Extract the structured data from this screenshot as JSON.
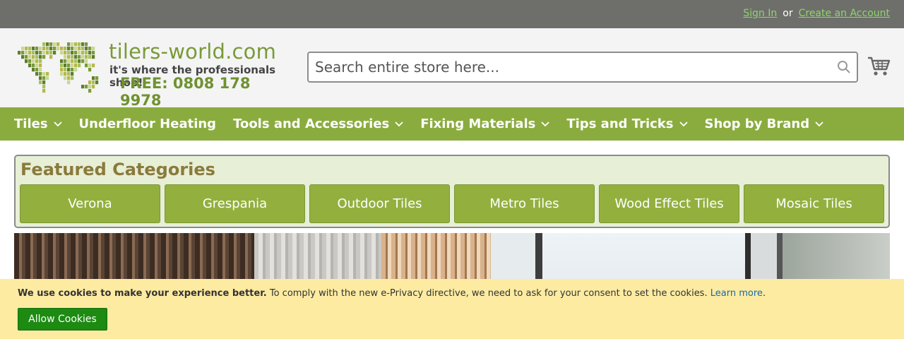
{
  "topbar": {
    "sign_in": "Sign In",
    "or": "or",
    "create_account": "Create an Account"
  },
  "logo": {
    "site": "tilers-world.com",
    "tagline": "it's where the professionals shop!",
    "phone": "FREE: 0808 178 9978"
  },
  "search": {
    "placeholder": "Search entire store here..."
  },
  "nav": {
    "items": [
      {
        "label": "Tiles",
        "has_dropdown": true
      },
      {
        "label": "Underfloor Heating",
        "has_dropdown": false
      },
      {
        "label": "Tools and Accessories",
        "has_dropdown": true
      },
      {
        "label": "Fixing Materials",
        "has_dropdown": true
      },
      {
        "label": "Tips and Tricks",
        "has_dropdown": true
      },
      {
        "label": "Shop by Brand",
        "has_dropdown": true
      }
    ]
  },
  "featured": {
    "title": "Featured Categories",
    "categories": [
      "Verona",
      "Grespania",
      "Outdoor Tiles",
      "Metro Tiles",
      "Wood Effect Tiles",
      "Mosaic Tiles"
    ]
  },
  "cookie": {
    "bold": "We use cookies to make your experience better.",
    "text": " To comply with the new e-Privacy directive, we need to ask for your consent to set the cookies. ",
    "link": "Learn more",
    "end": ".",
    "allow": "Allow Cookies"
  },
  "colors": {
    "topbar": "#6e6f6b",
    "nav": "#8aac3e",
    "category_button": "#93b03f",
    "cookie_bar": "#fdeba2",
    "allow_button": "#1d8a12"
  }
}
